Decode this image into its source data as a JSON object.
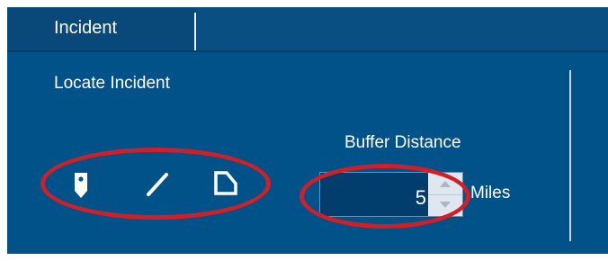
{
  "tabs": [
    {
      "label": "Incident",
      "active": true
    }
  ],
  "locate": {
    "label": "Locate Incident",
    "tools": [
      {
        "icon": "point-marker-icon",
        "name": "point"
      },
      {
        "icon": "line-icon",
        "name": "line"
      },
      {
        "icon": "polygon-icon",
        "name": "polygon"
      }
    ]
  },
  "buffer": {
    "label": "Buffer Distance",
    "value": "5",
    "units": "Miles"
  },
  "colors": {
    "panel": "#005289",
    "annotation": "#d11f27",
    "text": "#ffffff"
  }
}
